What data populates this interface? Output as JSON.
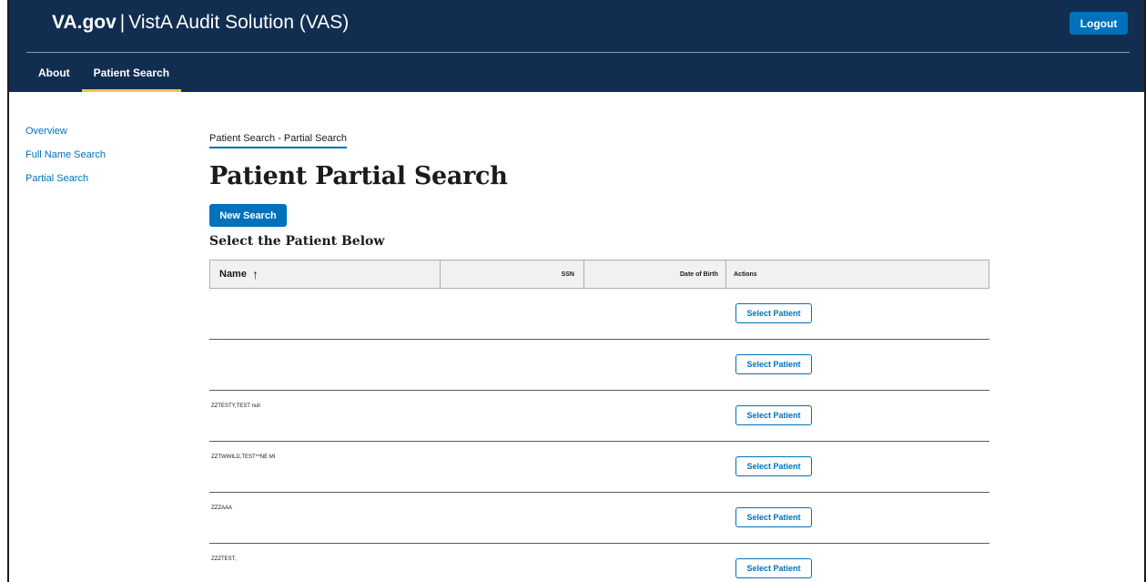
{
  "header": {
    "brand_va": "VA.gov",
    "brand_sep": "|",
    "brand_app": "VistA Audit Solution (VAS)",
    "logout_label": "Logout"
  },
  "nav": {
    "items": [
      {
        "label": "About",
        "active": false
      },
      {
        "label": "Patient Search",
        "active": true
      }
    ]
  },
  "sidebar": {
    "items": [
      {
        "label": "Overview"
      },
      {
        "label": "Full Name Search"
      },
      {
        "label": "Partial Search"
      }
    ]
  },
  "main": {
    "breadcrumb": "Patient Search - Partial Search",
    "title": "Patient Partial Search",
    "new_search_label": "New Search",
    "subtitle": "Select the Patient Below"
  },
  "table": {
    "columns": {
      "name": "Name",
      "sort_icon": "arrow-up-icon",
      "ssn": "SSN",
      "dob": "Date of Birth",
      "actions": "Actions"
    },
    "rows": [
      {
        "name": "",
        "action": "Select Patient"
      },
      {
        "name": "",
        "action": "Select Patient"
      },
      {
        "name": "ZZTESTY,TEST null",
        "action": "Select Patient"
      },
      {
        "name": "ZZTWWILD,TEST^*NE MI",
        "action": "Select Patient"
      },
      {
        "name": "ZZZAAA",
        "action": "Select Patient"
      },
      {
        "name": "ZZZTEST,",
        "action": "Select Patient"
      }
    ]
  },
  "colors": {
    "header_bg": "#112e51",
    "primary": "#0071bb",
    "active_underline": "#f9c642"
  }
}
